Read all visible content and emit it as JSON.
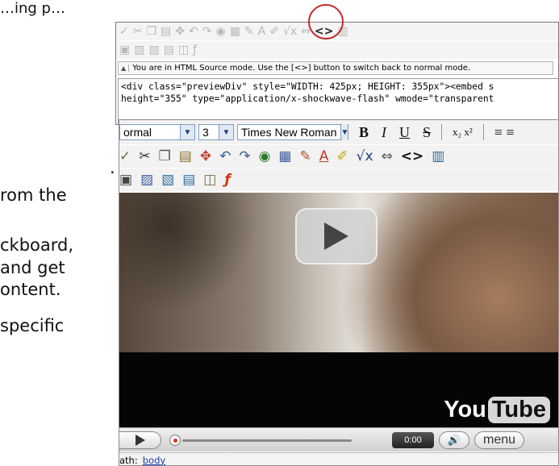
{
  "doc": {
    "top_fragment": "…ing p…",
    "lines": [
      ".",
      "rom the",
      "ckboard,",
      "and get",
      "ontent.",
      "specific"
    ]
  },
  "html_source_editor": {
    "toolbar_row1": [
      "spellcheck-icon",
      "cut-icon",
      "copy-icon",
      "paste-icon",
      "paste-word-icon",
      "undo-icon",
      "redo-icon",
      "link-icon",
      "table-icon",
      "pencil-icon",
      "font-color-icon",
      "highlight-icon",
      "formula-icon",
      "anchor-icon",
      "html-source-icon",
      "page-icon"
    ],
    "toolbar_row2": [
      "image-icon",
      "photo-icon",
      "document-icon",
      "page-icon",
      "embed-icon",
      "flash-icon"
    ],
    "source_toggle_glyph": "<>",
    "mode_message": "You are in HTML Source mode. Use the [<>] button to switch back to normal mode.",
    "source_text": "<div class=\"previewDiv\" style=\"WIDTH: 425px; HEIGHT: 355px\"><embed s\nheight=\"355\" type=\"application/x-shockwave-flash\" wmode=\"transparent"
  },
  "wysiwyg_editor": {
    "format_select": "ormal",
    "size_select": "3",
    "font_select": "Times New Roman",
    "format_buttons": [
      "B",
      "I",
      "U",
      "S"
    ],
    "sub_sup": "x₂ x²",
    "align_glyph": "≡ ≡",
    "source_glyph": "<>",
    "video": {
      "logo_you": "You",
      "logo_tube": "Tube",
      "time": "0:00",
      "menu_label": "menu"
    },
    "status": {
      "path_label": "ath:",
      "path_value": "body"
    }
  },
  "colors": {
    "highlight_ring": "#c62828",
    "select_border": "#7d9cbf",
    "link": "#1a3fb0"
  }
}
